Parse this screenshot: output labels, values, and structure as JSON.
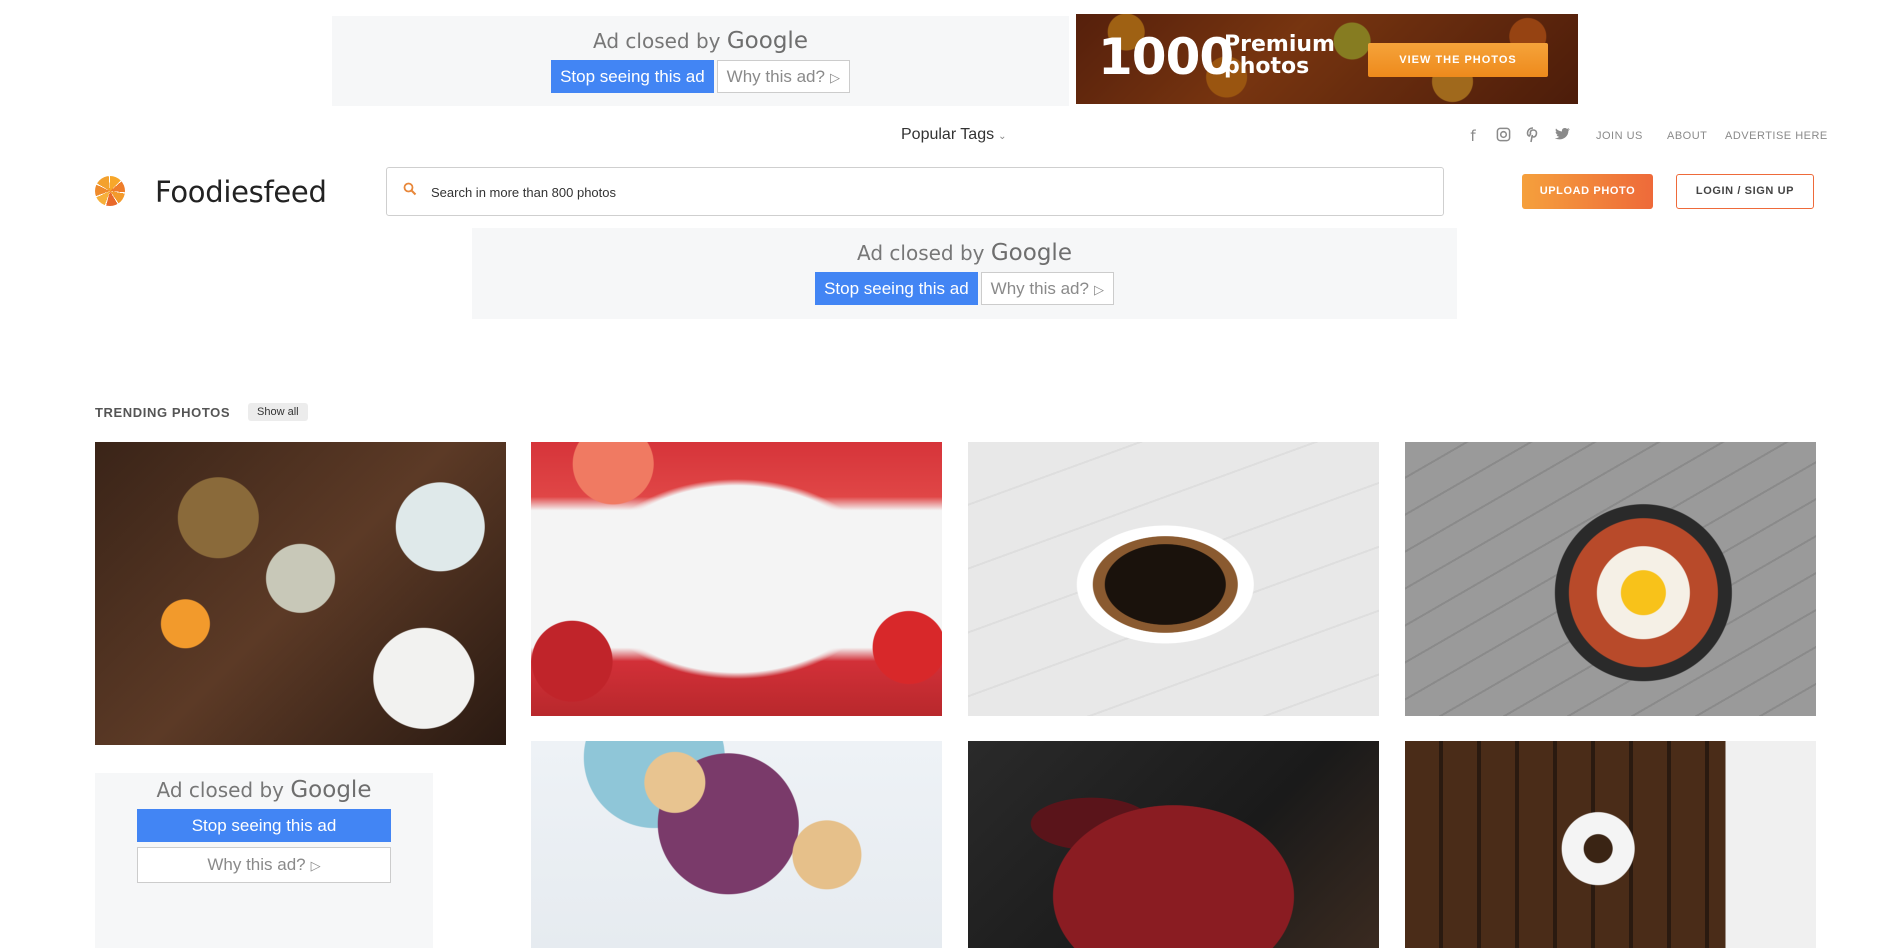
{
  "ads": {
    "closed_prefix": "Ad closed by",
    "brand": "Google",
    "stop_label": "Stop seeing this ad",
    "why_label": "Why this ad?",
    "why_icon": "play-triangle-icon"
  },
  "banner": {
    "number": "1000",
    "line1": "Premium",
    "line2": "photos",
    "cta": "VIEW THE PHOTOS"
  },
  "nav": {
    "popular_tags": "Popular Tags",
    "social_icons": [
      "facebook-icon",
      "instagram-icon",
      "pinterest-icon",
      "twitter-icon"
    ],
    "links": [
      "JOIN US",
      "ABOUT",
      "ADVERTISE HERE"
    ]
  },
  "header": {
    "logo_text": "Foodiesfeed",
    "search_placeholder": "Search in more than 800 photos",
    "upload_label": "UPLOAD PHOTO",
    "login_label": "LOGIN / SIGN UP"
  },
  "trending": {
    "title": "TRENDING PHOTOS",
    "show_all": "Show all"
  },
  "colors": {
    "accent": "#ee6a3a",
    "accent_light": "#f5a03c",
    "google_blue": "#4285f4"
  }
}
